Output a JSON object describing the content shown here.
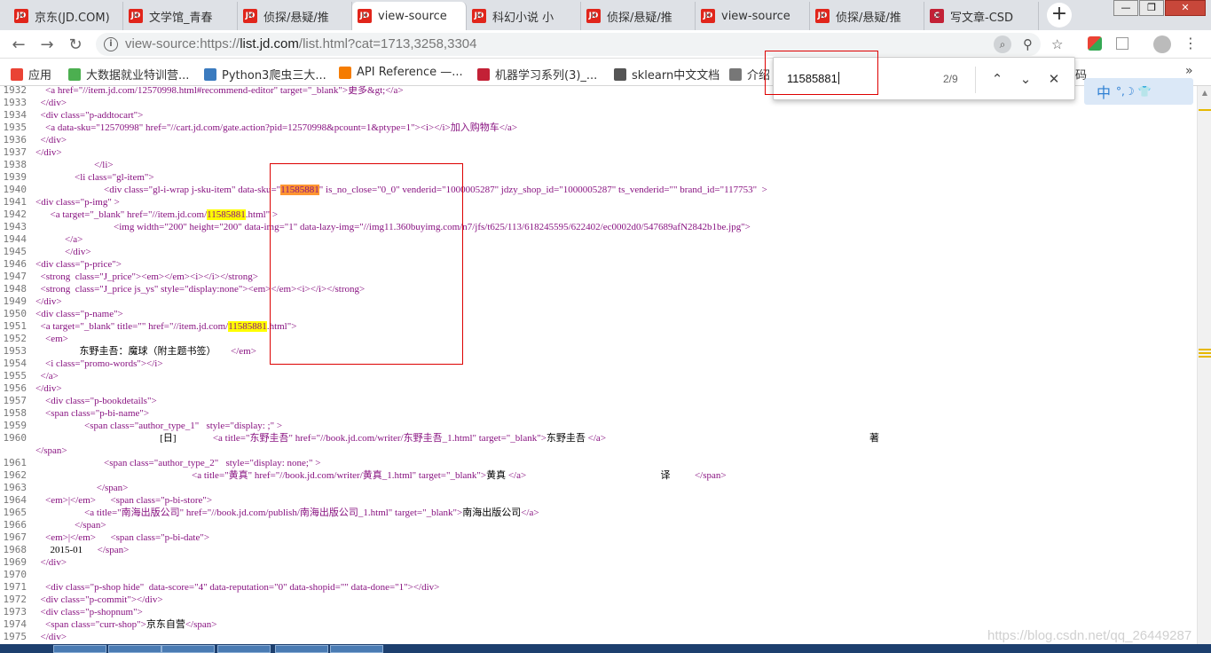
{
  "tabs": [
    {
      "favicon": "jd",
      "label": "京东(JD.COM)",
      "active": false
    },
    {
      "favicon": "jd",
      "label": "文学馆_青春",
      "active": false
    },
    {
      "favicon": "jd",
      "label": "侦探/悬疑/推",
      "active": false
    },
    {
      "favicon": "jd",
      "label": "view-source",
      "active": true
    },
    {
      "favicon": "jd",
      "label": "科幻小说 小",
      "active": false
    },
    {
      "favicon": "jd",
      "label": "侦探/悬疑/推",
      "active": false
    },
    {
      "favicon": "jd",
      "label": "view-source",
      "active": false
    },
    {
      "favicon": "jd",
      "label": "侦探/悬疑/推",
      "active": false
    },
    {
      "favicon": "csdn",
      "label": "写文章-CSD",
      "active": false
    }
  ],
  "colors": {
    "jd": "#e1251b",
    "csdn": "#c32136",
    "find_highlight": "#ffff00",
    "find_current": "#ff9632",
    "red_box": "#dd0000"
  },
  "icons": {
    "back": "arrow-left-icon",
    "forward": "arrow-right-icon",
    "reload": "reload-icon",
    "lock": "info-icon",
    "find": "magnifier-icon",
    "zoom": "zoom-icon",
    "star": "bookmark-star-icon",
    "close": "close-icon"
  },
  "address": {
    "scheme": "view-source:https://",
    "host": "list.jd.com",
    "path": "/list.html?cat=1713,3258,3304"
  },
  "bookmarks": [
    {
      "label": "应用",
      "color": "#ea4335"
    },
    {
      "label": "大数据就业特训营...",
      "color": "#4caf50"
    },
    {
      "label": "Python3爬虫三大...",
      "color": "#3b7bbf"
    },
    {
      "label": "API Reference —...",
      "color": "#f57c00"
    },
    {
      "label": "机器学习系列(3)_...",
      "color": "#c32136"
    },
    {
      "label": "sklearn中文文档",
      "color": "#555555"
    },
    {
      "label": "介绍",
      "color": "#777777"
    }
  ],
  "bookmark_tail": "码",
  "find": {
    "query": "11585881",
    "count": "2/9",
    "prev": "⌃",
    "next": "⌄",
    "close": "✕"
  },
  "ime": {
    "zh": "中",
    "sym": "°,☽"
  },
  "watermark": "https://blog.csdn.net/qq_26449287",
  "lines": [
    {
      "n": "1932",
      "segs": [
        [
          "p",
          "    <a href=\"//item.jd.com/12570998.html#recommend-editor\" target=\"_blank\">更多&gt;</a>"
        ]
      ]
    },
    {
      "n": "1933",
      "segs": [
        [
          "p",
          "  </div>"
        ]
      ]
    },
    {
      "n": "1934",
      "segs": [
        [
          "p",
          "  <div class=\"p-addtocart\">"
        ]
      ]
    },
    {
      "n": "1935",
      "segs": [
        [
          "p",
          "    <a data-sku=\"12570998\" href=\"//cart.jd.com/gate.action?pid=12570998&pcount=1&ptype=1\"><i></i>加入购物车</a>"
        ]
      ]
    },
    {
      "n": "1936",
      "segs": [
        [
          "p",
          "  </div>"
        ]
      ]
    },
    {
      "n": "1937",
      "segs": [
        [
          "p",
          "</div>"
        ]
      ]
    },
    {
      "n": "1938",
      "segs": [
        [
          "p",
          "                        </li>"
        ]
      ]
    },
    {
      "n": "1939",
      "segs": [
        [
          "p",
          "                <li class=\"gl-item\">"
        ]
      ]
    },
    {
      "n": "1940",
      "segs": [
        [
          "p",
          "                            <div class=\"gl-i-wrap j-sku-item\" data-sku=\""
        ],
        [
          "o",
          "11585881"
        ],
        [
          "p",
          "\" is_no_close=\"0_0\" venderid=\"1000005287\" jdzy_shop_id=\"1000005287\" ts_venderid=\"\" brand_id=\"117753\"  >"
        ]
      ]
    },
    {
      "n": "1941",
      "segs": [
        [
          "p",
          "<div class=\"p-img\" >"
        ]
      ]
    },
    {
      "n": "1942",
      "segs": [
        [
          "p",
          "      <a target=\"_blank\" href=\"//item.jd.com/"
        ],
        [
          "y",
          "11585881"
        ],
        [
          "p",
          ".html\" >"
        ]
      ]
    },
    {
      "n": "1943",
      "segs": [
        [
          "p",
          "                                <img width=\"200\" height=\"200\" data-img=\"1\" data-lazy-img=\"//img11.360buyimg.com/n7/jfs/t625/113/618245595/622402/ec0002d0/547689afN2842b1be.jpg\">"
        ]
      ]
    },
    {
      "n": "1944",
      "segs": [
        [
          "p",
          "            </a>"
        ]
      ]
    },
    {
      "n": "1945",
      "segs": [
        [
          "p",
          "            </div>"
        ]
      ]
    },
    {
      "n": "1946",
      "segs": [
        [
          "p",
          "<div class=\"p-price\">"
        ]
      ]
    },
    {
      "n": "1947",
      "segs": [
        [
          "p",
          "  <strong  class=\"J_price\"><em></em><i></i></strong>"
        ]
      ]
    },
    {
      "n": "1948",
      "segs": [
        [
          "p",
          "  <strong  class=\"J_price js_ys\" style=\"display:none\"><em></em><i></i></strong>"
        ]
      ]
    },
    {
      "n": "1949",
      "segs": [
        [
          "p",
          "</div>"
        ]
      ]
    },
    {
      "n": "1950",
      "segs": [
        [
          "p",
          "<div class=\"p-name\">"
        ]
      ]
    },
    {
      "n": "1951",
      "segs": [
        [
          "p",
          "  <a target=\"_blank\" title=\"\" href=\"//item.jd.com/"
        ],
        [
          "y",
          "11585881"
        ],
        [
          "p",
          ".html\">"
        ]
      ]
    },
    {
      "n": "1952",
      "segs": [
        [
          "p",
          "    <em>"
        ]
      ]
    },
    {
      "n": "1953",
      "segs": [
        [
          "t",
          "                  东野圭吾：魔球（附主题书签）      "
        ],
        [
          "p",
          "</em>"
        ]
      ]
    },
    {
      "n": "1954",
      "segs": [
        [
          "p",
          "    <i class=\"promo-words\"></i>"
        ]
      ]
    },
    {
      "n": "1955",
      "segs": [
        [
          "p",
          "  </a>"
        ]
      ]
    },
    {
      "n": "1956",
      "segs": [
        [
          "p",
          "</div>"
        ]
      ]
    },
    {
      "n": "1957",
      "segs": [
        [
          "p",
          "    <div class=\"p-bookdetails\">"
        ]
      ]
    },
    {
      "n": "1958",
      "segs": [
        [
          "p",
          "    <span class=\"p-bi-name\">"
        ]
      ]
    },
    {
      "n": "1959",
      "segs": [
        [
          "p",
          "                    <span class=\"author_type_1\"   style=\"display: ;\" >"
        ]
      ]
    },
    {
      "n": "1960",
      "segs": [
        [
          "t",
          "                                                   [日]               "
        ],
        [
          "p",
          "<a title=\"东野圭吾\" href=\"//book.jd.com/writer/东野圭吾_1.html\" target=\"_blank\">"
        ],
        [
          "t",
          "东野圭吾 "
        ],
        [
          "p",
          "</a>"
        ],
        [
          "t",
          "                                                                                                            著"
        ]
      ]
    },
    {
      "n": "",
      "segs": [
        [
          "p",
          "</span>"
        ]
      ]
    },
    {
      "n": "1961",
      "segs": [
        [
          "p",
          "                            <span class=\"author_type_2\"   style=\"display: none;\" >"
        ]
      ]
    },
    {
      "n": "1962",
      "segs": [
        [
          "p",
          "                                                                <a title=\"黄真\" href=\"//book.jd.com/writer/黄真_1.html\" target=\"_blank\">"
        ],
        [
          "t",
          "黄真 "
        ],
        [
          "p",
          "</a>"
        ],
        [
          "t",
          "                                                       译          "
        ],
        [
          "p",
          "</span>"
        ]
      ]
    },
    {
      "n": "1963",
      "segs": [
        [
          "p",
          "                         </span>"
        ]
      ]
    },
    {
      "n": "1964",
      "segs": [
        [
          "p",
          "    <em>|</em>      <span class=\"p-bi-store\">"
        ]
      ]
    },
    {
      "n": "1965",
      "segs": [
        [
          "p",
          "                    <a title=\"南海出版公司\" href=\"//book.jd.com/publish/南海出版公司_1.html\" target=\"_blank\">"
        ],
        [
          "t",
          "南海出版公司"
        ],
        [
          "p",
          "</a>"
        ]
      ]
    },
    {
      "n": "1966",
      "segs": [
        [
          "p",
          "                </span>"
        ]
      ]
    },
    {
      "n": "1967",
      "segs": [
        [
          "p",
          "    <em>|</em>      <span class=\"p-bi-date\">"
        ]
      ]
    },
    {
      "n": "1968",
      "segs": [
        [
          "t",
          "      2015-01      "
        ],
        [
          "p",
          "</span>"
        ]
      ]
    },
    {
      "n": "1969",
      "segs": [
        [
          "p",
          "  </div>"
        ]
      ]
    },
    {
      "n": "1970",
      "segs": [
        [
          "p",
          ""
        ]
      ]
    },
    {
      "n": "1971",
      "segs": [
        [
          "p",
          "    <div class=\"p-shop hide\"  data-score=\"4\" data-reputation=\"0\" data-shopid=\"\" data-done=\"1\"></div>"
        ]
      ]
    },
    {
      "n": "1972",
      "segs": [
        [
          "p",
          "  <div class=\"p-commit\"></div>"
        ]
      ]
    },
    {
      "n": "1973",
      "segs": [
        [
          "p",
          "  <div class=\"p-shopnum\">"
        ]
      ]
    },
    {
      "n": "1974",
      "segs": [
        [
          "p",
          "    <span class=\"curr-shop\">"
        ],
        [
          "t",
          "京东自营"
        ],
        [
          "p",
          "</span>"
        ]
      ]
    },
    {
      "n": "1975",
      "segs": [
        [
          "p",
          "  </div>"
        ]
      ]
    }
  ]
}
